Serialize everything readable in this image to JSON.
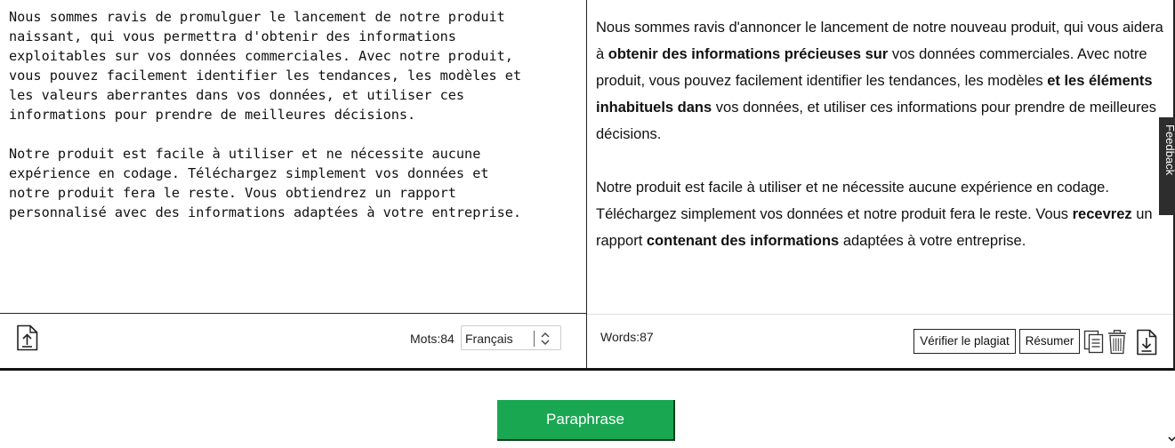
{
  "input": {
    "text": "Nous sommes ravis de promulguer le lancement de notre produit\nnaissant, qui vous permettra d'obtenir des informations\nexploitables sur vos données commerciales. Avec notre produit,\nvous pouvez facilement identifier les tendances, les modèles et\nles valeurs aberrantes dans vos données, et utiliser ces\ninformations pour prendre de meilleures décisions.\n\nNotre produit est facile à utiliser et ne nécessite aucune\nexpérience en codage. Téléchargez simplement vos données et\nnotre produit fera le reste. Vous obtiendrez un rapport\npersonnalisé avec des informations adaptées à votre entreprise.",
    "word_count_label": "Mots:84",
    "language": "Français",
    "upload_icon": "upload-file-icon"
  },
  "output": {
    "paragraphs": [
      [
        {
          "text": "Nous sommes ravis d'annoncer le lancement de notre nouveau produit, qui vous aidera à ",
          "bold": false
        },
        {
          "text": "obtenir des informations précieuses sur",
          "bold": true
        },
        {
          "text": " vos données commerciales. Avec notre produit, vous pouvez facilement identifier les tendances, les modèles ",
          "bold": false
        },
        {
          "text": "et les éléments inhabituels dans",
          "bold": true
        },
        {
          "text": " vos données, et utiliser ces informations pour prendre de meilleures décisions.",
          "bold": false
        }
      ],
      [
        {
          "text": "Notre produit est facile à utiliser et ne nécessite aucune expérience en codage. Téléchargez simplement vos données et notre produit fera le reste. Vous ",
          "bold": false
        },
        {
          "text": "recevrez",
          "bold": true
        },
        {
          "text": " un rapport ",
          "bold": false
        },
        {
          "text": "contenant des informations",
          "bold": true
        },
        {
          "text": " adaptées à votre entreprise.",
          "bold": false
        }
      ]
    ],
    "word_count_label": "Words:87",
    "plagiarism_label": "Vérifier le plagiat",
    "summarize_label": "Résumer",
    "icons": [
      "copy-icon",
      "trash-icon",
      "download-icon"
    ]
  },
  "feedback_label": "Feedback",
  "paraphrase_label": "Paraphrase",
  "colors": {
    "primary_button": "#1aa752",
    "feedback_tab": "#2d2d2d",
    "border": "#222222"
  }
}
